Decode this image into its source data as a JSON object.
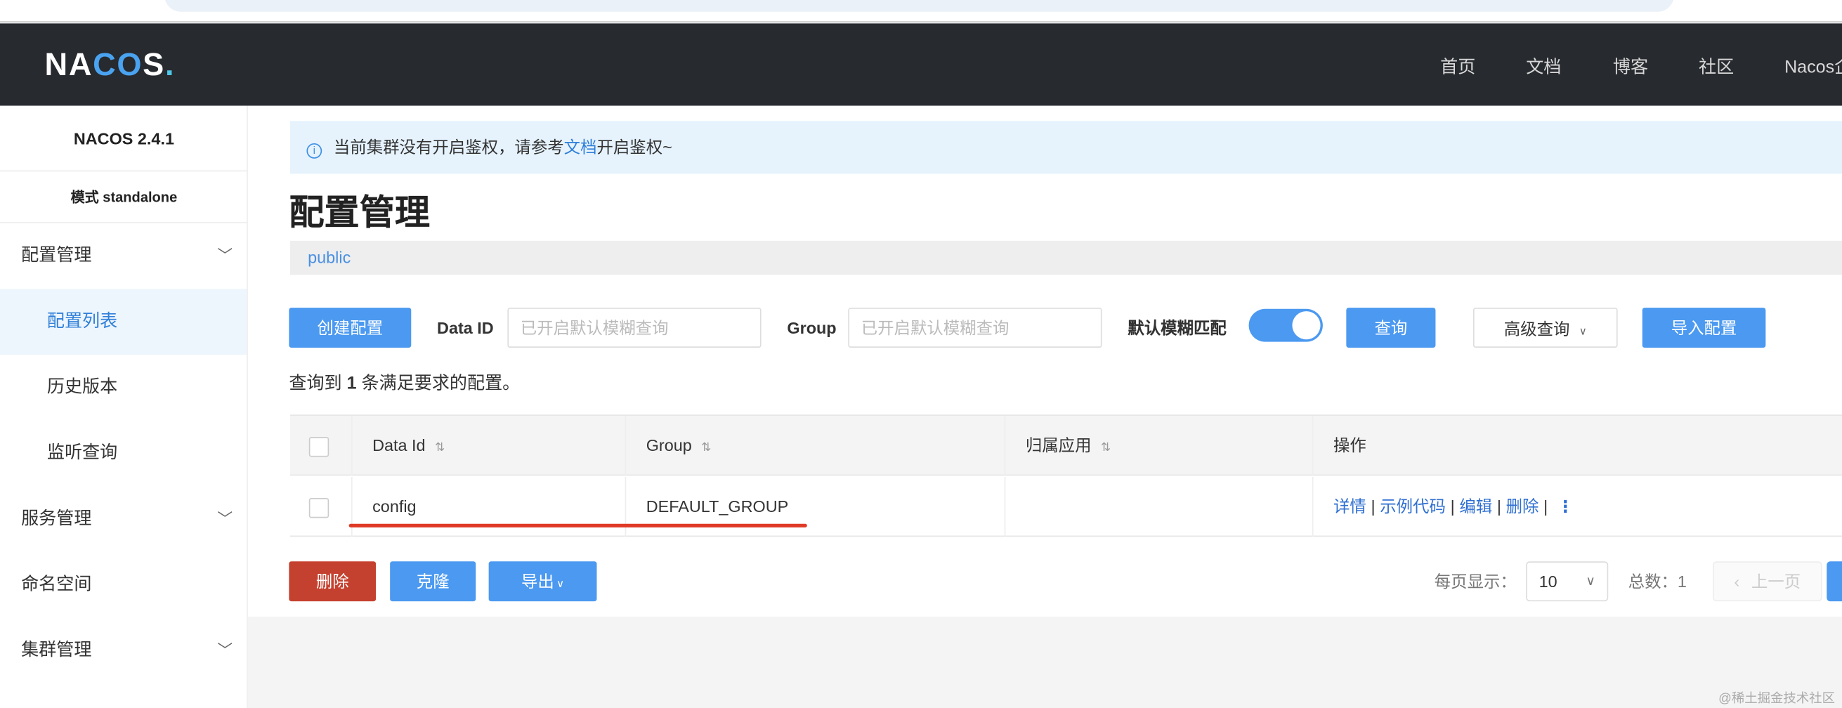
{
  "header": {
    "logo": "NACOS.",
    "nav": [
      "首页",
      "文档",
      "博客",
      "社区",
      "Nacos企"
    ]
  },
  "sidebar": {
    "version": "NACOS 2.4.1",
    "mode": "模式 standalone",
    "items": [
      {
        "label": "配置管理",
        "expandable": true
      },
      {
        "label": "配置列表",
        "active": true
      },
      {
        "label": "历史版本"
      },
      {
        "label": "监听查询"
      },
      {
        "label": "服务管理",
        "expandable": true
      },
      {
        "label": "命名空间"
      },
      {
        "label": "集群管理",
        "expandable": true
      }
    ]
  },
  "alert": {
    "pre": "当前集群没有开启鉴权，请参考",
    "link": "文档",
    "post": "开启鉴权~"
  },
  "page_title": "配置管理",
  "namespace": "public",
  "toolbar": {
    "create": "创建配置",
    "data_id_label": "Data ID",
    "data_id_placeholder": "已开启默认模糊查询",
    "group_label": "Group",
    "group_placeholder": "已开启默认模糊查询",
    "fuzzy_label": "默认模糊匹配",
    "fuzzy_on": true,
    "query": "查询",
    "advanced": "高级查询",
    "import": "导入配置"
  },
  "result": {
    "pre": "查询到 ",
    "count": "1",
    "post": " 条满足要求的配置。"
  },
  "table": {
    "headers": [
      "Data Id",
      "Group",
      "归属应用",
      "操作"
    ],
    "rows": [
      {
        "data_id": "config",
        "group": "DEFAULT_GROUP",
        "app": "",
        "ops": [
          "详情",
          "示例代码",
          "编辑",
          "删除"
        ]
      }
    ]
  },
  "bottom": {
    "delete": "删除",
    "clone": "克隆",
    "export": "导出"
  },
  "pagination": {
    "per_page_label": "每页显示：",
    "per_page": "10",
    "total_label": "总数：",
    "total": "1",
    "prev": "上一页"
  },
  "colors": {
    "primary": "#4b99f0",
    "danger": "#c5412f",
    "header": "#272a2f",
    "underline": "#e03a26"
  },
  "watermark": "@稀土掘金技术社区"
}
